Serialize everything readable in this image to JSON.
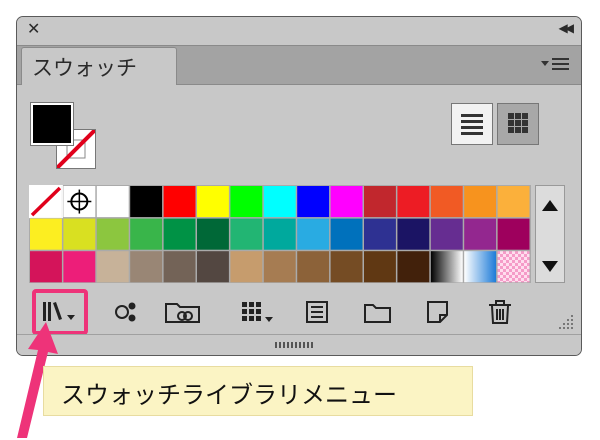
{
  "panel": {
    "close_glyph": "✕",
    "collapse_glyph": "◀◀",
    "tab_label": "スウォッチ",
    "menu_icon": "panel-menu-icon"
  },
  "swatches": {
    "rows": [
      [
        "none",
        "registration",
        "#ffffff",
        "#000000",
        "#ff0000",
        "#ffff00",
        "#00ff00",
        "#00ffff",
        "#0000ff",
        "#ff00ff",
        "#c1272d",
        "#ed1c24",
        "#f15a24",
        "#f7931e",
        "#fbb03b"
      ],
      [
        "#fcee21",
        "#d9e021",
        "#8cc63f",
        "#39b54a",
        "#009245",
        "#006837",
        "#22b573",
        "#00a99d",
        "#29abe2",
        "#0071bc",
        "#2e3192",
        "#1b1464",
        "#662d91",
        "#93278f",
        "#9e005d"
      ],
      [
        "#d4145a",
        "#ed1e79",
        "#c7b299",
        "#998675",
        "#736357",
        "#534741",
        "#c69c6d",
        "#a67c52",
        "#8c6239",
        "#754c24",
        "#603813",
        "#42210b",
        "gradient-gray",
        "gradient-blue",
        "pattern-pink"
      ]
    ],
    "selected_index": 0
  },
  "toolbar": {
    "icons": [
      "swatch-library-menu-icon",
      "show-swatch-kinds-icon",
      "open-cc-library-icon",
      "swatch-options-icon",
      "new-color-group-icon",
      "new-folder-icon",
      "new-swatch-icon",
      "delete-swatch-icon"
    ]
  },
  "colors": {
    "highlight": "#ee3379",
    "tooltip_bg": "#fbf4c4",
    "panel_bg": "#c8c8c8"
  },
  "tooltip": {
    "text": "スウォッチライブラリメニュー"
  }
}
